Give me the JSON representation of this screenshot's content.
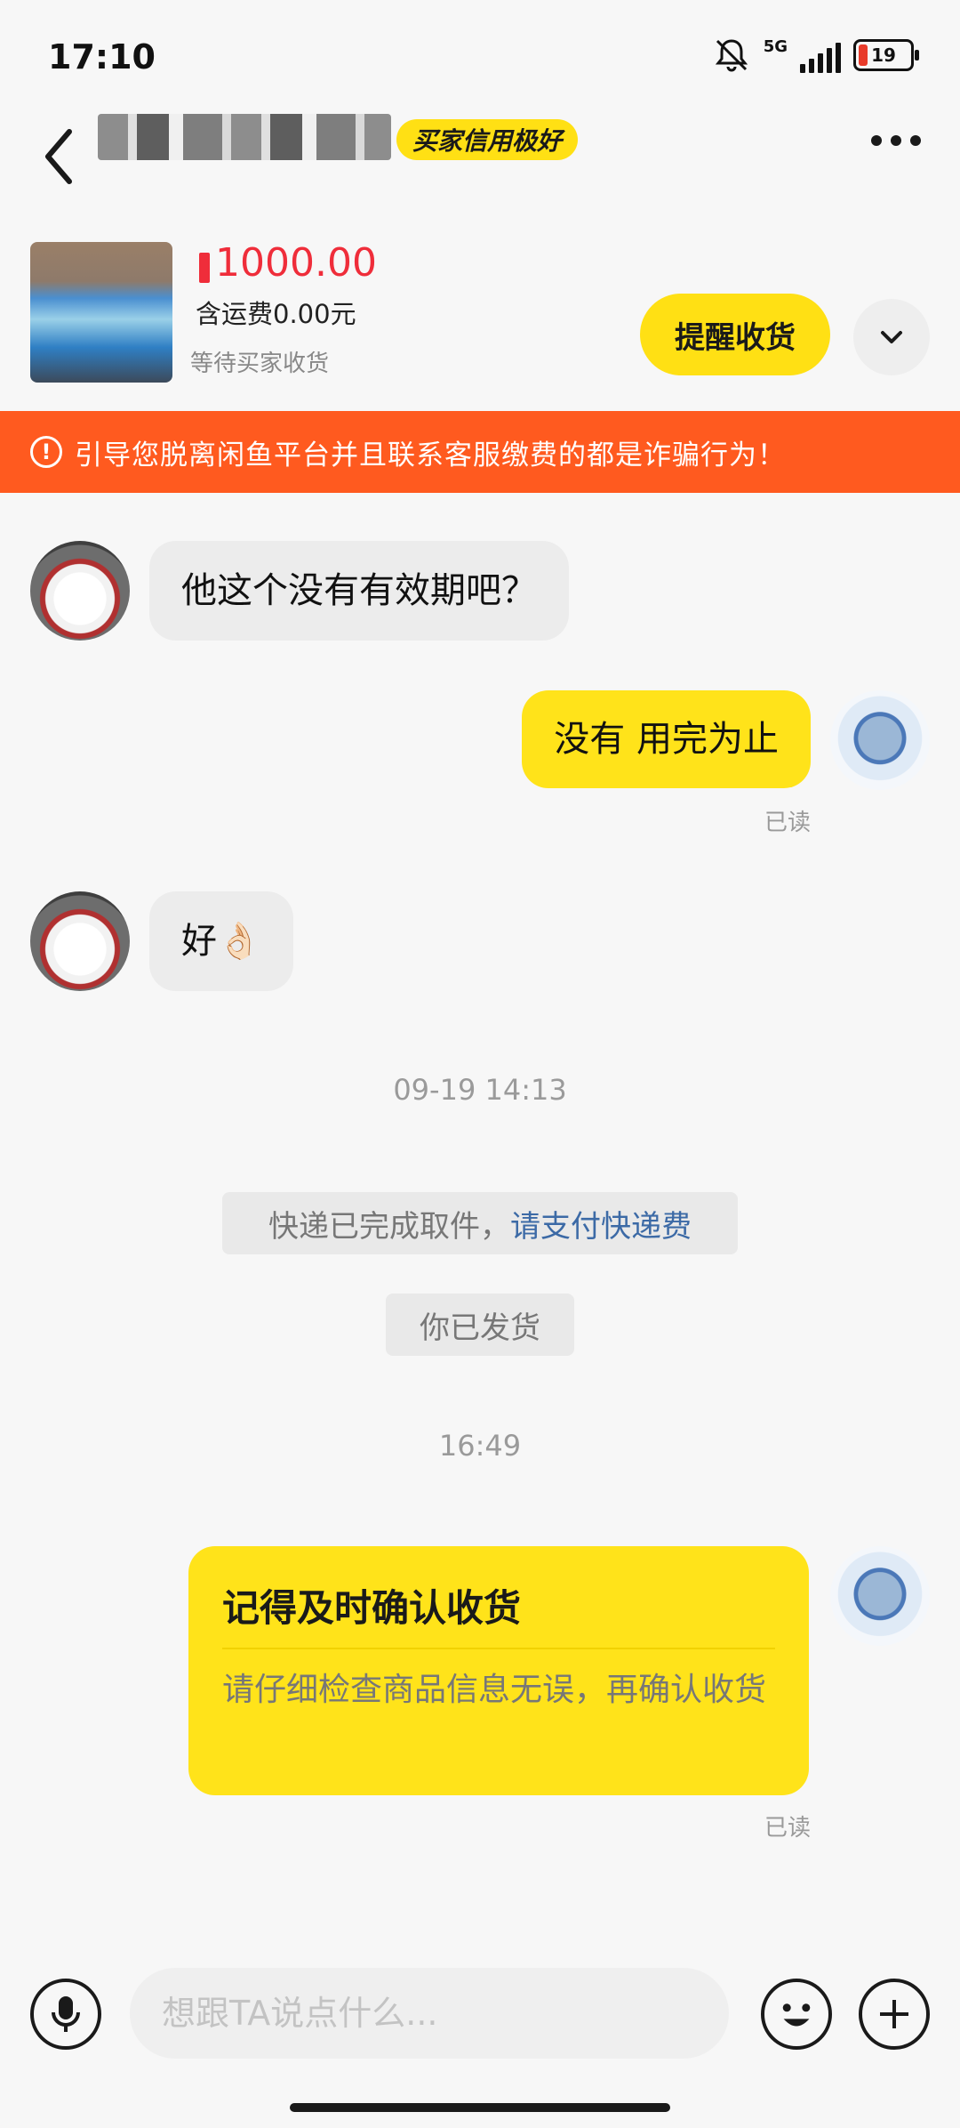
{
  "status_bar": {
    "time": "17:10",
    "network": "5G",
    "battery": "19"
  },
  "header": {
    "credit_badge": "买家信用极好"
  },
  "product": {
    "price": "1000.00",
    "shipping": "含运费0.00元",
    "status": "等待买家收货",
    "remind_label": "提醒收货"
  },
  "warning": {
    "icon": "!",
    "text": "引导您脱离闲鱼平台并且联系客服缴费的都是诈骗行为！"
  },
  "messages": {
    "m1": "他这个没有有效期吧？",
    "m2": "没有 用完为止",
    "m2_read": "已读",
    "m3": "好👌🏻",
    "ts1": "09-19 14:13",
    "sys1_text": "快递已完成取件，",
    "sys1_link": "请支付快递费",
    "sys2": "你已发货",
    "ts2": "16:49",
    "card_title": "记得及时确认收货",
    "card_body": "请仔细检查商品信息无误，再确认收货",
    "card_read": "已读"
  },
  "input": {
    "placeholder": "想跟TA说点什么..."
  },
  "colors": {
    "accent_yellow": "#ffe31a",
    "warning_orange": "#ff5a1f",
    "price_red": "#ef2d3a"
  }
}
